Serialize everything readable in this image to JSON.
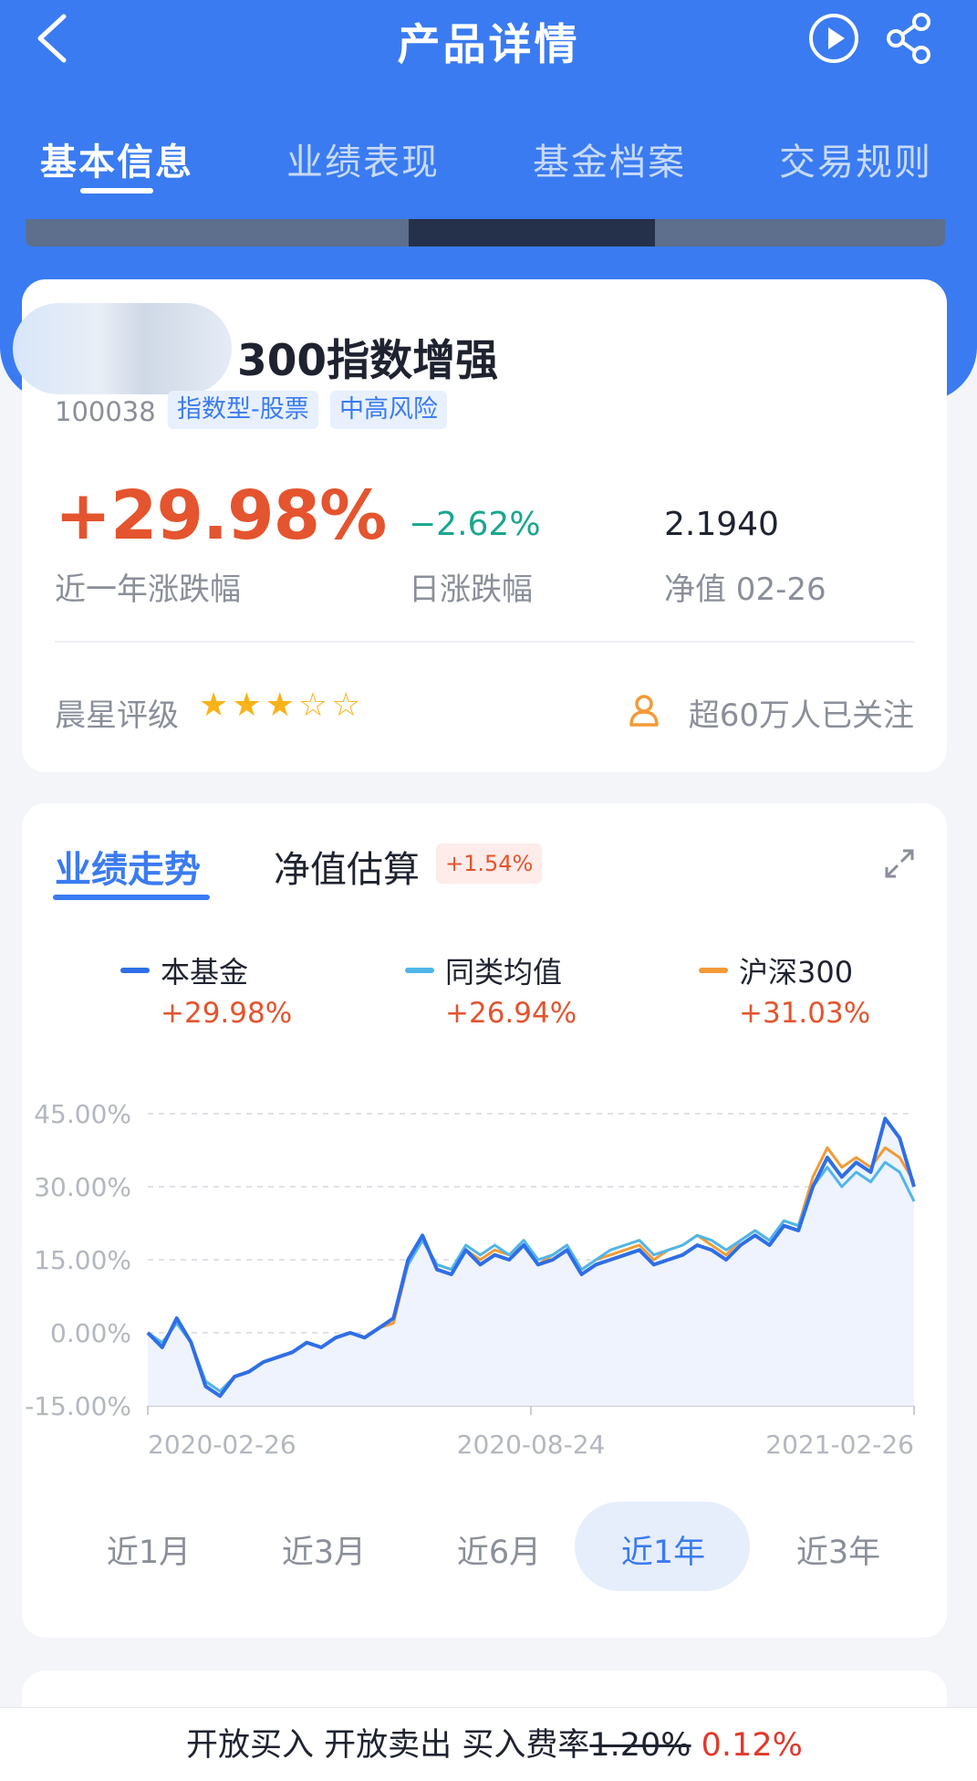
{
  "header": {
    "title": "产品详情"
  },
  "tabs": [
    {
      "label": "基本信息",
      "active": true
    },
    {
      "label": "业绩表现",
      "active": false
    },
    {
      "label": "基金档案",
      "active": false
    },
    {
      "label": "交易规则",
      "active": false
    }
  ],
  "fund": {
    "name": "300指数增强",
    "code": "100038",
    "tags": [
      "指数型-股票",
      "中高风险"
    ],
    "year_change": "+29.98%",
    "year_change_label": "近一年涨跌幅",
    "day_change": "−2.62%",
    "day_change_label": "日涨跌幅",
    "nav": "2.1940",
    "nav_label": "净值 02-26",
    "rating_label": "晨星评级",
    "rating_stars": 3,
    "rating_max": 5,
    "followers": "超60万人已关注"
  },
  "chart_section": {
    "tab_trend": "业绩走势",
    "tab_estimate": "净值估算",
    "estimate_badge": "+1.54%",
    "periods": [
      "近1月",
      "近3月",
      "近6月",
      "近1年",
      "近3年"
    ],
    "active_period": "近1年"
  },
  "chart_data": {
    "type": "line",
    "yticks": [
      "45.00%",
      "30.00%",
      "15.00%",
      "0.00%",
      "-15.00%"
    ],
    "ylim": [
      -15,
      45
    ],
    "xticks": [
      "2020-02-26",
      "2020-08-24",
      "2021-02-26"
    ],
    "series": [
      {
        "name": "本基金",
        "value_label": "+29.98%",
        "color": "#2f6ee6",
        "values": [
          0,
          -3,
          3,
          -2,
          -11,
          -13,
          -9,
          -8,
          -6,
          -5,
          -4,
          -2,
          -3,
          -1,
          0,
          -1,
          1,
          3,
          15,
          20,
          13,
          12,
          17,
          14,
          16,
          15,
          18,
          14,
          15,
          17,
          12,
          14,
          15,
          16,
          17,
          14,
          15,
          16,
          18,
          17,
          15,
          18,
          20,
          18,
          22,
          21,
          30,
          36,
          32,
          35,
          33,
          44,
          40,
          30
        ]
      },
      {
        "name": "同类均值",
        "value_label": "+26.94%",
        "color": "#4fb6ea",
        "values": [
          0,
          -2,
          2,
          -2,
          -10,
          -12,
          -9,
          -8,
          -6,
          -5,
          -4,
          -2,
          -3,
          -1,
          0,
          -1,
          1,
          3,
          14,
          19,
          14,
          13,
          18,
          16,
          18,
          16,
          19,
          15,
          16,
          18,
          13,
          15,
          17,
          18,
          19,
          16,
          17,
          18,
          20,
          19,
          17,
          19,
          21,
          19,
          23,
          22,
          30,
          34,
          30,
          33,
          31,
          35,
          33,
          27
        ]
      },
      {
        "name": "沪深300",
        "value_label": "+31.03%",
        "color": "#f39a36",
        "values": [
          0,
          -2,
          2,
          -2,
          -10,
          -12,
          -9,
          -8,
          -6,
          -5,
          -4,
          -2,
          -3,
          -1,
          0,
          -1,
          1,
          2,
          14,
          19,
          14,
          13,
          17,
          15,
          17,
          16,
          18,
          14,
          16,
          18,
          13,
          15,
          16,
          17,
          18,
          15,
          17,
          18,
          20,
          18,
          16,
          19,
          21,
          19,
          23,
          22,
          32,
          38,
          34,
          36,
          34,
          38,
          36,
          31
        ]
      }
    ]
  },
  "bottom_bar": {
    "buy_open": "开放买入",
    "sell_open": "开放卖出",
    "fee_label": "买入费率",
    "fee_original": "1.20%",
    "fee_current": "0.12%"
  },
  "colors": {
    "brand_blue": "#3a7bf1",
    "rise_red": "#e4542e",
    "fall_green": "#19a68f"
  }
}
